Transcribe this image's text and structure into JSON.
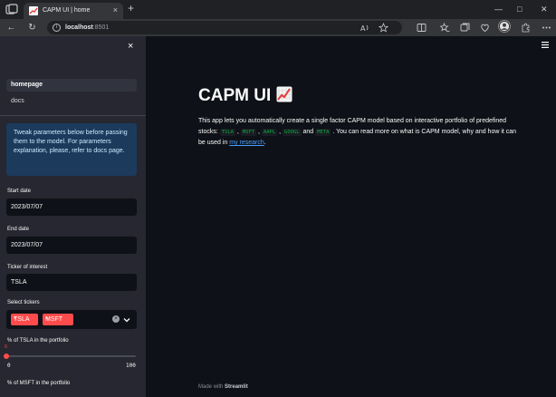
{
  "browser": {
    "tab_title": "CAPM UI | home",
    "tab_close": "×",
    "new_tab": "+",
    "url_host": "localhost",
    "url_port": ":8501",
    "win_minimize": "—",
    "win_maximize": "□",
    "win_close": "✕",
    "back": "←",
    "reload": "↻"
  },
  "sidebar": {
    "close": "×",
    "nav": [
      {
        "label": "homepage"
      },
      {
        "label": "docs"
      }
    ],
    "info": "Tweak parameters below before passing them to the model. For parameters explanation, please, refer to docs page.",
    "start_date_label": "Start date",
    "start_date_value": "2023/07/07",
    "end_date_label": "End date",
    "end_date_value": "2023/07/07",
    "ticker_label": "Ticker of interest",
    "ticker_value": "TSLA",
    "select_label": "Select tickers",
    "selected_tickers": [
      "TSLA",
      "MSFT"
    ],
    "chip_remove": "×",
    "clear_icon": "×",
    "chevron": "⌄",
    "slider1_label": "% of TSLA in the portfolio",
    "slider1_value": "0",
    "slider_min": "0",
    "slider_max": "100",
    "slider2_label": "% of MSFT in the portfolio"
  },
  "main": {
    "title": "CAPM UI",
    "intro_before": "This app lets you automatically create a single factor CAPM model based on interactive portfolio of predefined stocks: ",
    "tickers": [
      "TSLA",
      "MSFT",
      "AAPL",
      "GOOGL",
      "META"
    ],
    "and_word": " and ",
    "intro_after": " . You can read more on what is CAPM model, why and how it can be used in ",
    "link_text": "my research",
    "period": ".",
    "footer_prefix": "Made with ",
    "footer_brand": "Streamlit"
  },
  "colors": {
    "accent": "#ff4b4b",
    "sidebar_bg": "#262730",
    "app_bg": "#0e1117",
    "code_green": "#09ab3b",
    "link_blue": "#4a9eff"
  }
}
